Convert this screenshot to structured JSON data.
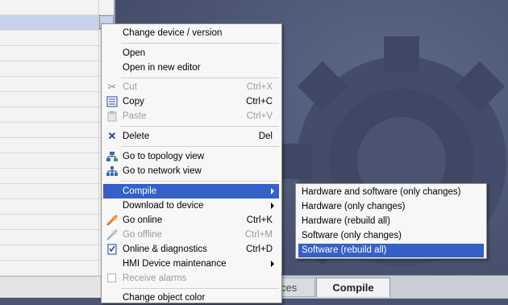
{
  "menu": {
    "items": [
      {
        "label": "Change device / version"
      },
      {
        "label": "Open"
      },
      {
        "label": "Open in new editor"
      },
      {
        "label": "Cut",
        "shortcut": "Ctrl+X",
        "icon": "scissors-icon"
      },
      {
        "label": "Copy",
        "shortcut": "Ctrl+C",
        "icon": "copy-icon"
      },
      {
        "label": "Paste",
        "shortcut": "Ctrl+V",
        "icon": "paste-icon"
      },
      {
        "label": "Delete",
        "shortcut": "Del",
        "icon": "delete-x-icon"
      },
      {
        "label": "Go to topology view",
        "icon": "topology-icon"
      },
      {
        "label": "Go to network view",
        "icon": "network-icon"
      },
      {
        "label": "Compile"
      },
      {
        "label": "Download to device"
      },
      {
        "label": "Go online",
        "shortcut": "Ctrl+K",
        "icon": "go-online-icon"
      },
      {
        "label": "Go offline",
        "shortcut": "Ctrl+M",
        "icon": "go-offline-icon"
      },
      {
        "label": "Online & diagnostics",
        "shortcut": "Ctrl+D",
        "icon": "diagnostics-icon"
      },
      {
        "label": "HMI Device maintenance"
      },
      {
        "label": "Receive alarms"
      },
      {
        "label": "Change object color"
      }
    ]
  },
  "submenu": {
    "items": [
      {
        "label": "Hardware and software (only changes)"
      },
      {
        "label": "Hardware (only changes)"
      },
      {
        "label": "Hardware (rebuild all)"
      },
      {
        "label": "Software (only changes)"
      },
      {
        "label": "Software (rebuild all)"
      }
    ]
  },
  "tabs": {
    "prev_label": "ces",
    "active_label": "Compile"
  },
  "colors": {
    "highlight": "#3460c8",
    "editor_bg": "#4a5472"
  }
}
